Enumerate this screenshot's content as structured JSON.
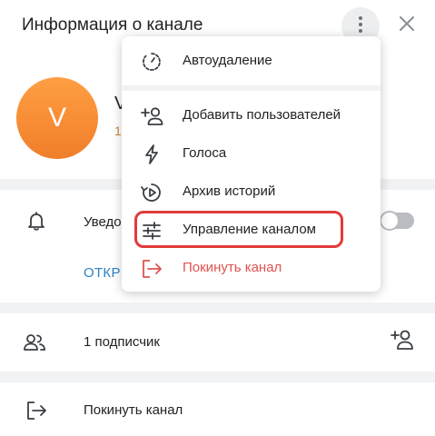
{
  "header": {
    "title": "Информация о канале"
  },
  "profile": {
    "avatar_letter": "V",
    "name": "V",
    "subtitle": "1"
  },
  "notifications": {
    "label": "Уведомления",
    "enabled": false
  },
  "link": {
    "label": "ОТКРЫТЬ"
  },
  "subscribers": {
    "label": "1 подписчик"
  },
  "leave": {
    "label": "Покинуть канал"
  },
  "menu": {
    "items": [
      {
        "label": "Автоудаление",
        "icon": "timer-icon"
      },
      {
        "label": "Добавить пользователей",
        "icon": "add-user-icon"
      },
      {
        "label": "Голоса",
        "icon": "boost-icon"
      },
      {
        "label": "Архив историй",
        "icon": "stories-archive-icon"
      },
      {
        "label": "Управление каналом",
        "icon": "sliders-icon"
      },
      {
        "label": "Покинуть канал",
        "icon": "leave-icon",
        "color": "#e0524f"
      }
    ]
  },
  "colors": {
    "accent": "#2d82c6",
    "danger": "#e0524f",
    "highlight": "#e23a3a",
    "avatar": "#f08a30"
  }
}
